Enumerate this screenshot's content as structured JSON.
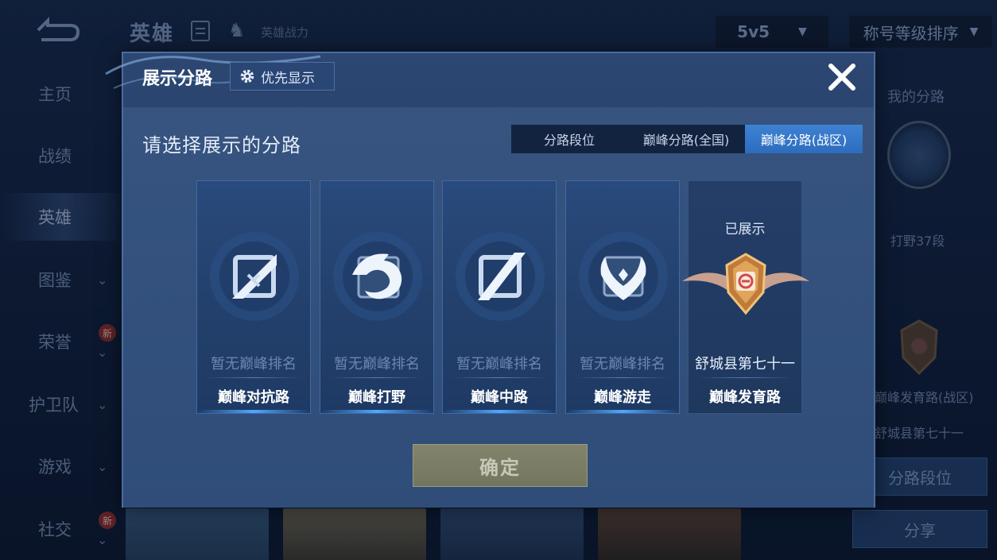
{
  "header": {
    "title": "英雄",
    "power_label": "英雄战力",
    "mode": "5v5",
    "sort": "称号等级排序"
  },
  "sidebar": {
    "items": [
      {
        "label": "主页",
        "expandable": false,
        "new": false
      },
      {
        "label": "战绩",
        "expandable": false,
        "new": false
      },
      {
        "label": "英雄",
        "expandable": false,
        "new": false,
        "active": true
      },
      {
        "label": "图鉴",
        "expandable": true,
        "new": false
      },
      {
        "label": "荣誉",
        "expandable": true,
        "new": true
      },
      {
        "label": "护卫队",
        "expandable": true,
        "new": false
      },
      {
        "label": "游戏",
        "expandable": true,
        "new": false
      },
      {
        "label": "社交",
        "expandable": true,
        "new": true
      }
    ],
    "new_badge": "新"
  },
  "right_panel": {
    "title": "我的分路",
    "rank1": "打野37段",
    "lane2": "巅峰发育路(战区)",
    "region2": "舒城县第七十一",
    "lane_rank_button": "分路段位",
    "share_button": "分享"
  },
  "modal": {
    "title": "展示分路",
    "priority_label": "优先显示",
    "subtitle": "请选择展示的分路",
    "tabs": [
      {
        "label": "分路段位",
        "active": false
      },
      {
        "label": "巅峰分路(全国)",
        "active": false
      },
      {
        "label": "巅峰分路(战区)",
        "active": true
      }
    ],
    "cards": [
      {
        "lane": "巅峰对抗路",
        "rank": "暂无巅峰排名",
        "icon": "sword-lane-icon",
        "displayed": false
      },
      {
        "lane": "巅峰打野",
        "rank": "暂无巅峰排名",
        "icon": "dragon-lane-icon",
        "displayed": false
      },
      {
        "lane": "巅峰中路",
        "rank": "暂无巅峰排名",
        "icon": "mid-lane-icon",
        "displayed": false
      },
      {
        "lane": "巅峰游走",
        "rank": "暂无巅峰排名",
        "icon": "wings-lane-icon",
        "displayed": false
      },
      {
        "lane": "巅峰发育路",
        "rank": "舒城县第七十一",
        "icon": "gold-shield-icon",
        "displayed": true,
        "displayed_label": "已展示"
      }
    ],
    "confirm_label": "确定"
  },
  "colors": {
    "accent_tab": "#3e82d4",
    "modal_bg": "#2c4772",
    "confirm_btn": "#8c8a6a"
  }
}
